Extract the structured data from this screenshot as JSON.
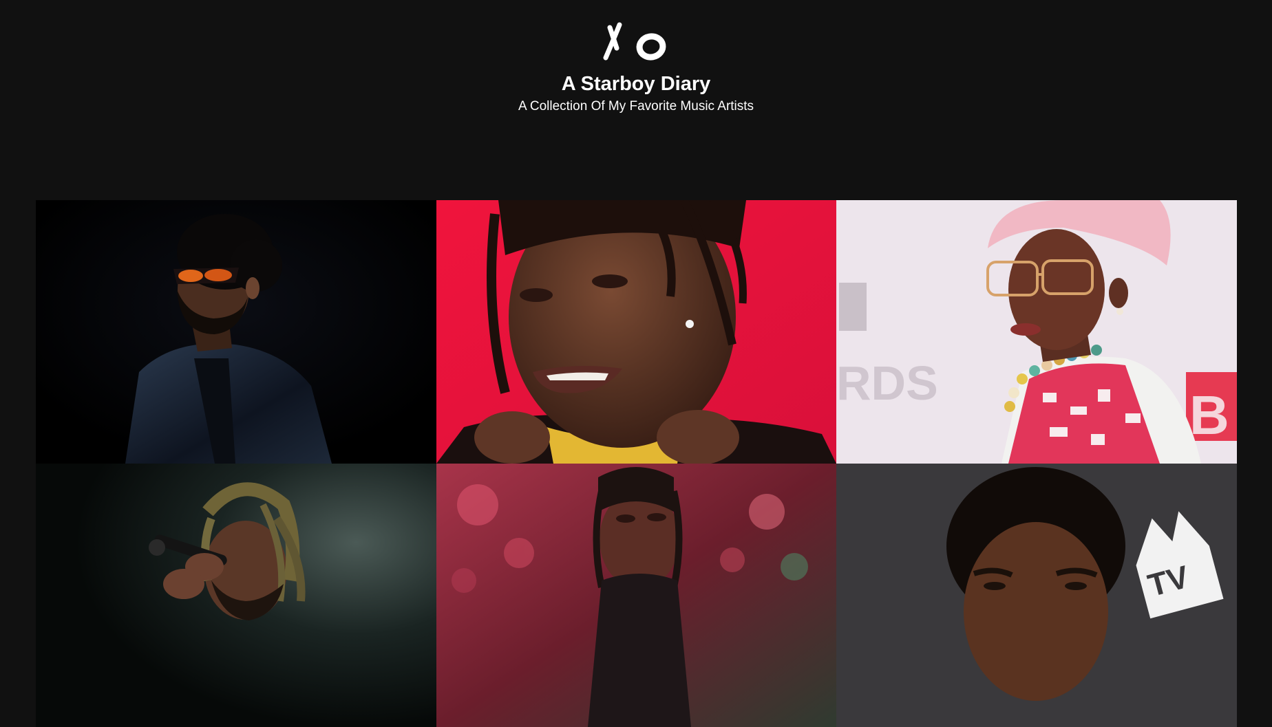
{
  "header": {
    "logo_text": "XO",
    "title": "A Starboy Diary",
    "subtitle": "A Collection Of My Favorite Music Artists"
  },
  "gallery": {
    "items": [
      {
        "name": "artist-photo-1",
        "icon": "portrait-sunglasses-black-background",
        "bg": "#030304"
      },
      {
        "name": "artist-photo-2",
        "icon": "portrait-braids-red-background",
        "bg": "#e8173d"
      },
      {
        "name": "artist-photo-3",
        "icon": "portrait-pink-hat-event-backdrop",
        "bg": "#ece4ea"
      },
      {
        "name": "artist-photo-4",
        "icon": "portrait-microphone-stage-dark",
        "bg": "#0d1311"
      },
      {
        "name": "artist-photo-5",
        "icon": "portrait-concert-red-lights",
        "bg": "#7c2131"
      },
      {
        "name": "artist-photo-6",
        "icon": "portrait-mtv-backdrop",
        "bg": "#3b3a3d"
      }
    ]
  },
  "colors": {
    "page_background": "#111111",
    "text": "#ffffff"
  }
}
